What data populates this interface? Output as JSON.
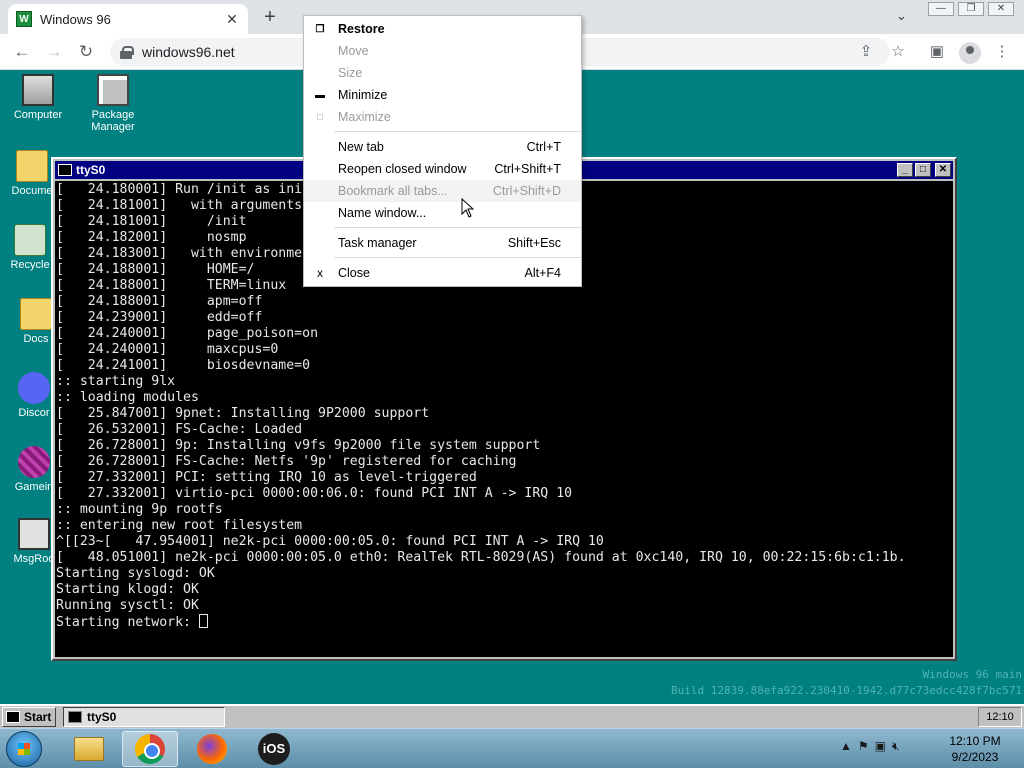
{
  "browser": {
    "tab_title": "Windows 96",
    "url": "windows96.net"
  },
  "desktop": {
    "icons": [
      {
        "label": "Computer"
      },
      {
        "label": "Package\nManager"
      },
      {
        "label": "Docume"
      },
      {
        "label": "Recycle"
      },
      {
        "label": "Docs"
      },
      {
        "label": "Discor"
      },
      {
        "label": "Gamein"
      },
      {
        "label": "MsgRoo"
      }
    ],
    "watermark_line1": "Windows 96 main",
    "watermark_line2": "Build 12839.88efa922.230410-1942.d77c73edcc428f7bc571"
  },
  "terminal": {
    "title": "ttyS0",
    "lines": [
      "[   24.180001] Run /init as init",
      "[   24.181001]   with arguments",
      "[   24.181001]     /init",
      "[   24.182001]     nosmp",
      "[   24.183001]   with environme",
      "[   24.188001]     HOME=/",
      "[   24.188001]     TERM=linux",
      "[   24.188001]     apm=off",
      "[   24.239001]     edd=off",
      "[   24.240001]     page_poison=on",
      "[   24.240001]     maxcpus=0",
      "[   24.241001]     biosdevname=0",
      ":: starting 9lx",
      ":: loading modules",
      "[   25.847001] 9pnet: Installing 9P2000 support",
      "[   26.532001] FS-Cache: Loaded",
      "[   26.728001] 9p: Installing v9fs 9p2000 file system support",
      "[   26.728001] FS-Cache: Netfs '9p' registered for caching",
      "[   27.332001] PCI: setting IRQ 10 as level-triggered",
      "[   27.332001] virtio-pci 0000:00:06.0: found PCI INT A -> IRQ 10",
      ":: mounting 9p rootfs",
      ":: entering new root filesystem",
      "^[[23~[   47.954001] ne2k-pci 0000:00:05.0: found PCI INT A -> IRQ 10",
      "[   48.051001] ne2k-pci 0000:00:05.0 eth0: RealTek RTL-8029(AS) found at 0xc140, IRQ 10, 00:22:15:6b:c1:1b.",
      "Starting syslogd: OK",
      "Starting klogd: OK",
      "Running sysctl: OK",
      "Starting network: "
    ]
  },
  "context_menu": {
    "restore": "Restore",
    "move": "Move",
    "size": "Size",
    "minimize": "Minimize",
    "maximize": "Maximize",
    "new_tab": "New tab",
    "new_tab_shortcut": "Ctrl+T",
    "reopen": "Reopen closed window",
    "reopen_shortcut": "Ctrl+Shift+T",
    "bookmark": "Bookmark all tabs...",
    "bookmark_shortcut": "Ctrl+Shift+D",
    "name_window": "Name window...",
    "task_manager": "Task manager",
    "task_manager_shortcut": "Shift+Esc",
    "close": "Close",
    "close_shortcut": "Alt+F4"
  },
  "w96_taskbar": {
    "start": "Start",
    "task": "ttyS0",
    "clock": "12:10"
  },
  "win7_taskbar": {
    "ios_label": "iOS",
    "time": "12:10 PM",
    "date": "9/2/2023"
  }
}
